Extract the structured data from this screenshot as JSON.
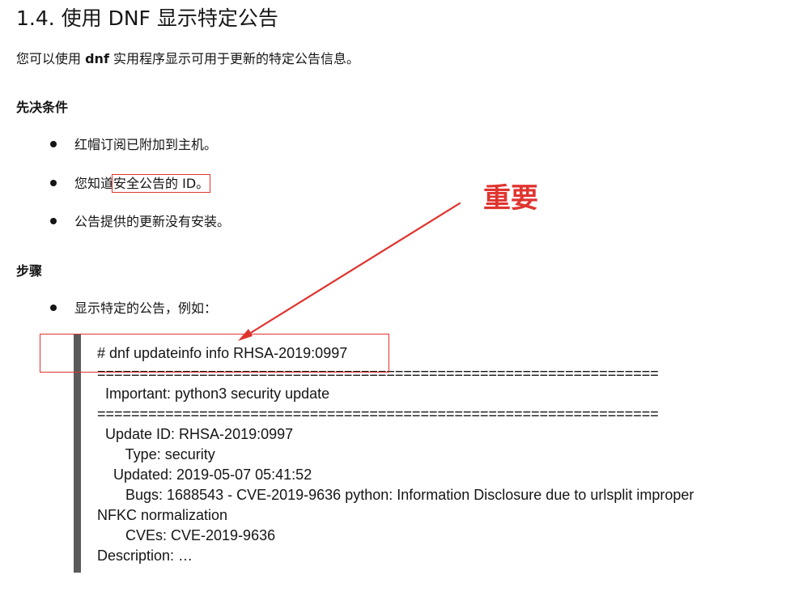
{
  "heading": "1.4. 使用 DNF 显示特定公告",
  "intro": {
    "before": "您可以使用 ",
    "command": "dnf",
    "after": " 实用程序显示可用于更新的特定公告信息。"
  },
  "prerequisites": {
    "title": "先决条件",
    "items": [
      {
        "text": "红帽订阅已附加到主机。"
      },
      {
        "before": "您知道",
        "boxed": "安全公告的 ID。"
      },
      {
        "text": "公告提供的更新没有安装。"
      }
    ]
  },
  "procedure": {
    "title": "步骤",
    "items": [
      {
        "text": "显示特定的公告，例如："
      }
    ]
  },
  "code": {
    "lines": [
      "# dnf updateinfo info RHSA-2019:0997",
      "==================================================================",
      "  Important: python3 security update",
      "==================================================================",
      "  Update ID: RHSA-2019:0997",
      "       Type: security",
      "    Updated: 2019-05-07 05:41:52",
      "       Bugs: 1688543 - CVE-2019-9636 python: Information Disclosure due to urlsplit improper",
      "NFKC normalization",
      "       CVEs: CVE-2019-9636",
      "Description: …"
    ]
  },
  "annotation": {
    "label": "重要",
    "color": "#e0342f"
  }
}
